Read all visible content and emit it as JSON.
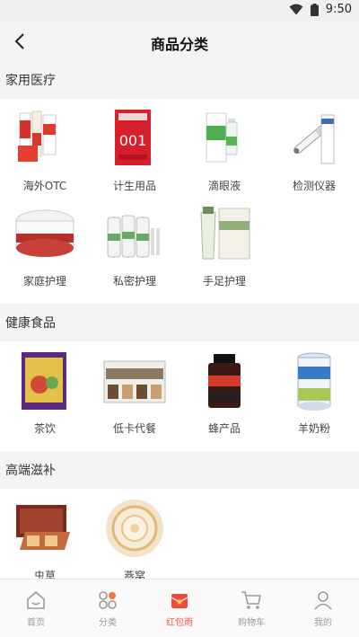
{
  "status": {
    "time": "9:50"
  },
  "header": {
    "title": "商品分类"
  },
  "sections": [
    {
      "title": "家用医疗",
      "items": [
        {
          "label": "海外OTC"
        },
        {
          "label": "计生用品"
        },
        {
          "label": "滴眼液"
        },
        {
          "label": "检测仪器"
        },
        {
          "label": "家庭护理"
        },
        {
          "label": "私密护理"
        },
        {
          "label": "手足护理"
        }
      ]
    },
    {
      "title": "健康食品",
      "items": [
        {
          "label": "茶饮"
        },
        {
          "label": "低卡代餐"
        },
        {
          "label": "蜂产品"
        },
        {
          "label": "羊奶粉"
        }
      ]
    },
    {
      "title": "高端滋补",
      "items": [
        {
          "label": "虫草"
        },
        {
          "label": "燕窝"
        }
      ]
    }
  ],
  "tabbar": {
    "items": [
      {
        "label": "首页",
        "icon": "home-icon"
      },
      {
        "label": "分类",
        "icon": "category-icon"
      },
      {
        "label": "红包雨",
        "icon": "red-envelope-icon"
      },
      {
        "label": "购物车",
        "icon": "cart-icon"
      },
      {
        "label": "我的",
        "icon": "profile-icon"
      }
    ],
    "active_color": "#ee5544",
    "inactive_color": "#9a9a9a"
  }
}
